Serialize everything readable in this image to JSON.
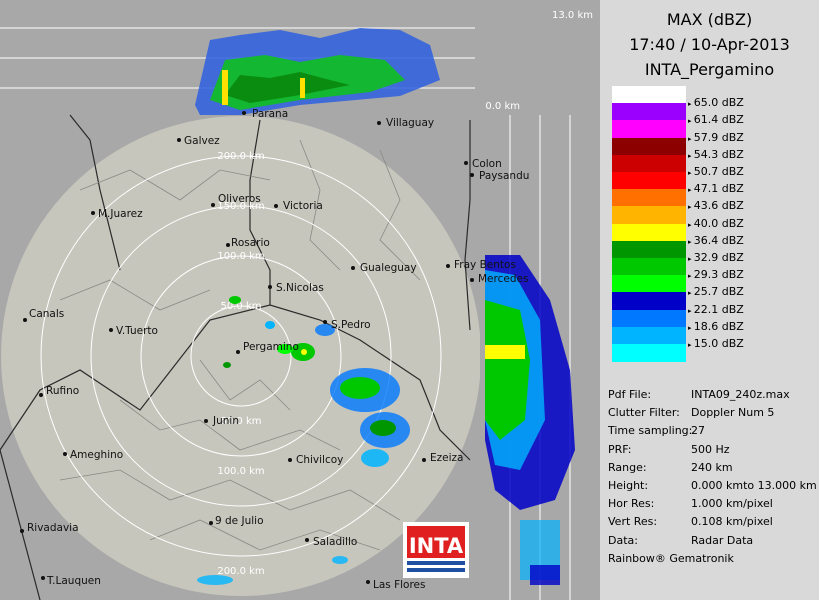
{
  "product": {
    "title": "MAX (dBZ)",
    "datetime": "17:40 / 10-Apr-2013",
    "station": "INTA_Pergamino"
  },
  "top_section": {
    "height_max_label": "13.0 km",
    "height_min_label": "0.0 km"
  },
  "range_rings": [
    {
      "label": "200.0 km"
    },
    {
      "label": "150.0 km"
    },
    {
      "label": "100.0 km"
    },
    {
      "label": "50.0 km"
    },
    {
      "label": "50.0 km"
    },
    {
      "label": "100.0 km"
    },
    {
      "label": "200.0 km"
    }
  ],
  "cities": [
    {
      "name": "Parana"
    },
    {
      "name": "Galvez"
    },
    {
      "name": "Villaguay"
    },
    {
      "name": "Colon"
    },
    {
      "name": "Paysandu"
    },
    {
      "name": "Oliveros"
    },
    {
      "name": "Victoria"
    },
    {
      "name": "M.Juarez"
    },
    {
      "name": "Rosario"
    },
    {
      "name": "Gualeguay"
    },
    {
      "name": "Fray Bentos"
    },
    {
      "name": "Mercedes"
    },
    {
      "name": "S.Nicolas"
    },
    {
      "name": "Canals"
    },
    {
      "name": "V.Tuerto"
    },
    {
      "name": "S.Pedro"
    },
    {
      "name": "Pergamino"
    },
    {
      "name": "Rufino"
    },
    {
      "name": "Junin"
    },
    {
      "name": "Ezeiza"
    },
    {
      "name": "Ameghino"
    },
    {
      "name": "Chivilcoy"
    },
    {
      "name": "Rivadavia"
    },
    {
      "name": "9 de Julio"
    },
    {
      "name": "Saladillo"
    },
    {
      "name": "T.Lauquen"
    },
    {
      "name": "Las Flores"
    }
  ],
  "logo": {
    "text": "INTA"
  },
  "legend": [
    {
      "label": "",
      "color": "#ffffff"
    },
    {
      "label": "65.0 dBZ",
      "color": "#9b00ff"
    },
    {
      "label": "61.4 dBZ",
      "color": "#ff00ff"
    },
    {
      "label": "57.9 dBZ",
      "color": "#8c0000"
    },
    {
      "label": "54.3 dBZ",
      "color": "#cc0000"
    },
    {
      "label": "50.7 dBZ",
      "color": "#ff0000"
    },
    {
      "label": "47.1 dBZ",
      "color": "#ff7000"
    },
    {
      "label": "43.6 dBZ",
      "color": "#ffb400"
    },
    {
      "label": "40.0 dBZ",
      "color": "#ffff00"
    },
    {
      "label": "36.4 dBZ",
      "color": "#009600"
    },
    {
      "label": "32.9 dBZ",
      "color": "#00c800"
    },
    {
      "label": "29.3 dBZ",
      "color": "#00ff00"
    },
    {
      "label": "25.7 dBZ",
      "color": "#0000c8"
    },
    {
      "label": "22.1 dBZ",
      "color": "#0078ff"
    },
    {
      "label": "18.6 dBZ",
      "color": "#00b4ff"
    },
    {
      "label": "15.0 dBZ",
      "color": "#00ffff"
    }
  ],
  "info": [
    {
      "key": "Pdf File:",
      "value": "INTA09_240z.max"
    },
    {
      "key": "Clutter Filter:",
      "value": "Doppler Num 5"
    },
    {
      "key": "Time sampling:",
      "value": "27"
    },
    {
      "key": "PRF:",
      "value": "500 Hz"
    },
    {
      "key": "Range:",
      "value": "240 km"
    },
    {
      "key": "Height:",
      "value": "0.000 kmto 13.000 km"
    },
    {
      "key": "Hor Res:",
      "value": "1.000 km/pixel"
    },
    {
      "key": "Vert Res:",
      "value": "0.108 km/pixel"
    },
    {
      "key": "Data:",
      "value": "Radar Data"
    }
  ],
  "footer": "Rainbow® Gematronik",
  "colors": {
    "map_background": "#a8a8a8",
    "radar_disc": "#c6c6bd",
    "panel_background": "#d9d9d9",
    "logo_red": "#e02020",
    "logo_blue": "#1f4fa3"
  }
}
